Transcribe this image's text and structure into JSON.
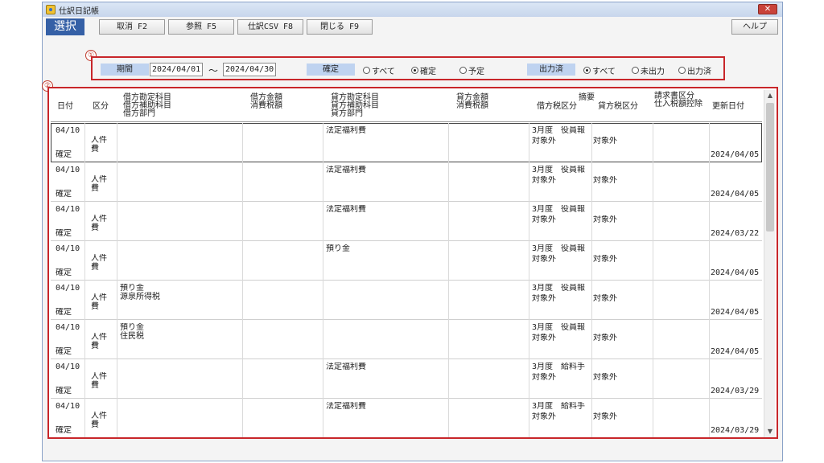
{
  "window": {
    "title": "仕訳日記帳",
    "close_label": "✕"
  },
  "toolbar": {
    "mode_label": "選択",
    "buttons": [
      "取消 F2",
      "参照 F5",
      "仕訳CSV F8",
      "閉じる F9"
    ],
    "help_label": "ヘルプ"
  },
  "callouts": {
    "filter": "①",
    "grid": "②"
  },
  "filter": {
    "period_label": "期間",
    "date_from": "2024/04/01",
    "separator": "～",
    "date_to": "2024/04/30",
    "confirm_label": "確定",
    "confirm_options": [
      "すべて",
      "確定",
      "予定"
    ],
    "confirm_selected": 1,
    "output_label": "出力済",
    "output_options": [
      "すべて",
      "未出力",
      "出力済"
    ],
    "output_selected": 0
  },
  "grid": {
    "headers": {
      "date": "日付",
      "kubun": "区分",
      "debit_account": "借方勘定科目\n借方補助科目\n借方部門",
      "debit_amount": "借方金額\n消費税額",
      "credit_account": "貸方勘定科目\n貸方補助科目\n貸方部門",
      "credit_amount": "貸方金額\n消費税額",
      "summary": "摘要",
      "debit_tax": "借方税区分",
      "credit_tax": "貸方税区分",
      "invoice": "請求書区分\n仕入税額控除",
      "updated": "更新日付"
    },
    "rows": [
      {
        "date": "04/10",
        "status": "確定",
        "kubun": "人件\n費",
        "debit_account": "",
        "credit_account": "法定福利費",
        "summary": "3月度　役員報",
        "debit_tax": "対象外",
        "credit_tax": "対象外",
        "updated": "2024/04/05"
      },
      {
        "date": "04/10",
        "status": "確定",
        "kubun": "人件\n費",
        "debit_account": "",
        "credit_account": "法定福利費",
        "summary": "3月度　役員報",
        "debit_tax": "対象外",
        "credit_tax": "対象外",
        "updated": "2024/04/05"
      },
      {
        "date": "04/10",
        "status": "確定",
        "kubun": "人件\n費",
        "debit_account": "",
        "credit_account": "法定福利費",
        "summary": "3月度　役員報",
        "debit_tax": "対象外",
        "credit_tax": "対象外",
        "updated": "2024/03/22"
      },
      {
        "date": "04/10",
        "status": "確定",
        "kubun": "人件\n費",
        "debit_account": "",
        "credit_account": "預り金",
        "summary": "3月度　役員報",
        "debit_tax": "対象外",
        "credit_tax": "対象外",
        "updated": "2024/04/05"
      },
      {
        "date": "04/10",
        "status": "確定",
        "kubun": "人件\n費",
        "debit_account": "預り金\n源泉所得税",
        "credit_account": "",
        "summary": "3月度　役員報",
        "debit_tax": "対象外",
        "credit_tax": "対象外",
        "updated": "2024/04/05"
      },
      {
        "date": "04/10",
        "status": "確定",
        "kubun": "人件\n費",
        "debit_account": "預り金\n住民税",
        "credit_account": "",
        "summary": "3月度　役員報",
        "debit_tax": "対象外",
        "credit_tax": "対象外",
        "updated": "2024/04/05"
      },
      {
        "date": "04/10",
        "status": "確定",
        "kubun": "人件\n費",
        "debit_account": "",
        "credit_account": "法定福利費",
        "summary": "3月度　給料手",
        "debit_tax": "対象外",
        "credit_tax": "対象外",
        "updated": "2024/03/29"
      },
      {
        "date": "04/10",
        "status": "確定",
        "kubun": "人件\n費",
        "debit_account": "",
        "credit_account": "法定福利費",
        "summary": "3月度　給料手",
        "debit_tax": "対象外",
        "credit_tax": "対象外",
        "updated": "2024/03/29"
      }
    ],
    "selected_row": 0
  },
  "colors": {
    "accent": "#3560a6",
    "label_bg": "#bfd3f0",
    "highlight": "#c8262a"
  }
}
